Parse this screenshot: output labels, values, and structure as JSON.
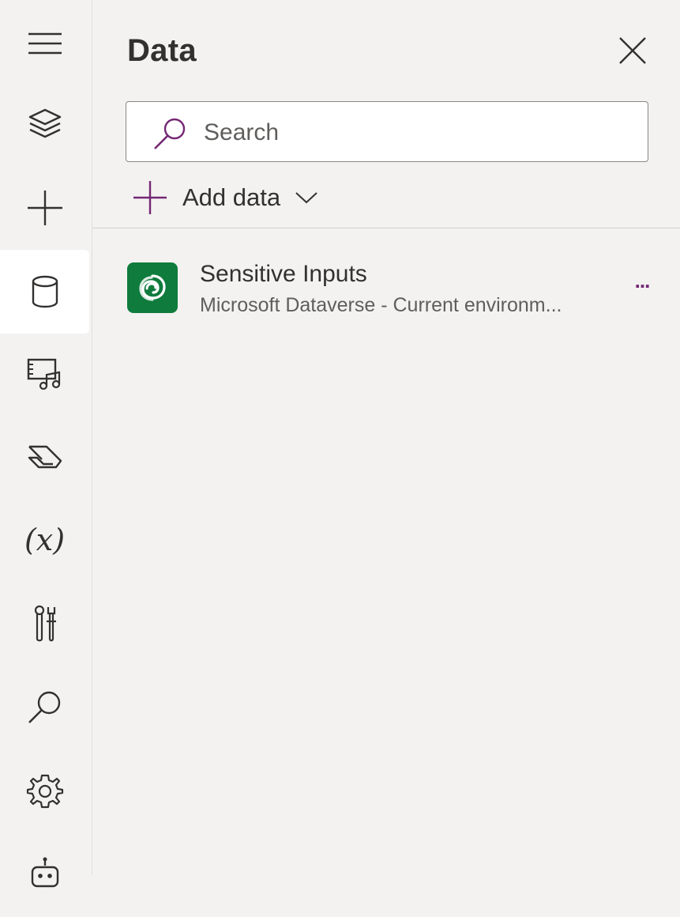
{
  "rail": {
    "items": [
      {
        "name": "hamburger-menu-icon"
      },
      {
        "name": "tree-view-layers-icon"
      },
      {
        "name": "insert-plus-icon"
      },
      {
        "name": "data-cylinder-icon",
        "selected": true
      },
      {
        "name": "media-icon"
      },
      {
        "name": "power-automate-icon"
      },
      {
        "name": "variables-icon",
        "text": "(x)"
      },
      {
        "name": "advanced-tools-icon"
      },
      {
        "name": "search-icon"
      },
      {
        "name": "settings-gear-icon"
      },
      {
        "name": "copilot-bot-icon"
      }
    ]
  },
  "panel": {
    "title": "Data",
    "search": {
      "placeholder": "Search",
      "value": ""
    },
    "add_data_label": "Add data",
    "sources": [
      {
        "name": "Sensitive Inputs",
        "description": "Microsoft Dataverse - Current environm...",
        "icon": "dataverse-icon",
        "more_label": "..."
      }
    ]
  },
  "colors": {
    "accent": "#742774",
    "dataverse_green": "#0f7b3d",
    "background": "#f3f2f1"
  }
}
